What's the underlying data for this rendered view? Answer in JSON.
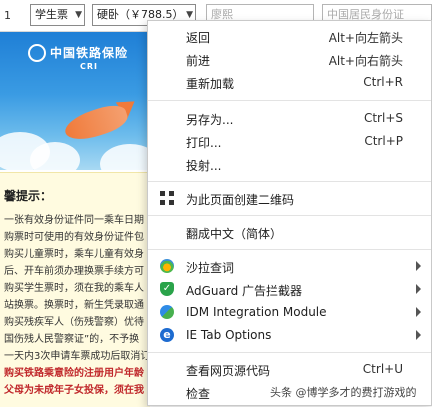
{
  "form_row": {
    "row_number": "1",
    "ticket_type": "学生票",
    "seat_type": "硬卧（￥788.5）",
    "name_placeholder": "廖熙",
    "id_type_placeholder": "中国居民身份证"
  },
  "banner": {
    "logo_text": "中国铁路保险",
    "logo_sub": "CRI"
  },
  "notice": {
    "title": "馨提示：",
    "lines": [
      "一张有效身份证件同一乘车日期",
      "购票时可使用的有效身份证件包",
      "购买儿童票时，乘车儿童有效身",
      "后、开车前须办理换票手续方可",
      "购买学生票时，须在我的乘车人",
      "站换票。换票时，新生凭录取通",
      "购买残疾军人（伤残警察）优待",
      "国伤残人民警察证”的，不予换",
      "一天内3次申请车票成功后取消订",
      "购买铁路乘意险的注册用户年龄",
      "父母为未成年子女投保，须在我"
    ]
  },
  "context_menu": {
    "back": {
      "label": "返回",
      "shortcut": "Alt+向左箭头"
    },
    "forward": {
      "label": "前进",
      "shortcut": "Alt+向右箭头"
    },
    "reload": {
      "label": "重新加载",
      "shortcut": "Ctrl+R"
    },
    "save_as": {
      "label": "另存为...",
      "shortcut": "Ctrl+S"
    },
    "print": {
      "label": "打印...",
      "shortcut": "Ctrl+P"
    },
    "cast": {
      "label": "投射..."
    },
    "qr": {
      "label": "为此页面创建二维码"
    },
    "translate": {
      "label": "翻成中文（简体）"
    },
    "salad": {
      "label": "沙拉查词"
    },
    "adguard": {
      "label": "AdGuard 广告拦截器"
    },
    "idm": {
      "label": "IDM Integration Module"
    },
    "ietab": {
      "label": "IE Tab Options"
    },
    "view_source": {
      "label": "查看网页源代码",
      "shortcut": "Ctrl+U"
    },
    "inspect": {
      "label": "检查"
    }
  },
  "watermark": "头条 @博学多才的费打游戏的",
  "colors": {
    "banner_blue": "#1f7fd6",
    "notice_bg": "#fffbe0",
    "adguard_green": "#2aa34a",
    "ie_blue": "#1d6bd0"
  },
  "icons": {
    "qr": "qr-code-icon",
    "salad": "salad-dict-icon",
    "adguard": "adguard-shield-icon",
    "idm": "idm-icon",
    "ietab": "ie-tab-icon",
    "submenu": "chevron-right-icon"
  }
}
